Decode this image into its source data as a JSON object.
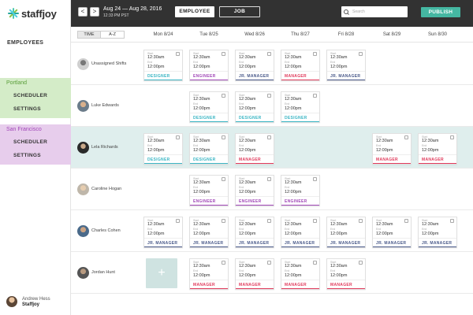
{
  "brand": {
    "name": "staffjoy"
  },
  "sidebar": {
    "employees_label": "EMPLOYEES",
    "locations": [
      {
        "name": "Portland",
        "links": [
          "SCHEDULER",
          "SETTINGS"
        ]
      },
      {
        "name": "San Francisco",
        "links": [
          "SCHEDULER",
          "SETTINGS"
        ]
      }
    ],
    "user": {
      "name": "Andrew Hess",
      "org": "Staffjoy"
    }
  },
  "topbar": {
    "prev": "<",
    "next": ">",
    "date_range": "Aug 24 — Aug 28, 2016",
    "time": "12:33 PM PST",
    "view_employee": "EMPLOYEE",
    "view_job": "JOB",
    "search_placeholder": "Search",
    "publish": "PUBLISH"
  },
  "sort": {
    "time": "TIME",
    "az": "A-Z"
  },
  "days": [
    "Mon 8/24",
    "Tue 8/25",
    "Wed 8/26",
    "Thu 8/27",
    "Fri 8/28",
    "Sat 8/29",
    "Sun 8/30"
  ],
  "shift_labels": {
    "start": "Start",
    "end": "End"
  },
  "add_symbol": "+",
  "colors": {
    "designer": "#3bb6c4",
    "engineer": "#a249b8",
    "jr_manager": "#4a5a8a",
    "manager": "#e03a5b",
    "publish": "#45b7a2",
    "topbar": "#323232"
  },
  "rows": [
    {
      "name": "Unassigned Shifts",
      "avatar": "gray",
      "highlight": false,
      "shifts": [
        {
          "day": 0,
          "start": "12:30am",
          "end": "12:00pm",
          "role": "DESIGNER"
        },
        {
          "day": 1,
          "start": "12:30am",
          "end": "12:00pm",
          "role": "ENGINEER"
        },
        {
          "day": 2,
          "start": "12:30am",
          "end": "12:00pm",
          "role": "JR. MANAGER"
        },
        {
          "day": 3,
          "start": "12:30am",
          "end": "12:00pm",
          "role": "MANAGER"
        },
        {
          "day": 4,
          "start": "12:30am",
          "end": "12:00pm",
          "role": "JR. MANAGER"
        }
      ]
    },
    {
      "name": "Luke Edwards",
      "avatar": "face",
      "highlight": false,
      "shifts": [
        {
          "day": 1,
          "start": "12:30am",
          "end": "12:00pm",
          "role": "DESIGNER"
        },
        {
          "day": 2,
          "start": "12:30am",
          "end": "12:00pm",
          "role": "DESIGNER"
        },
        {
          "day": 3,
          "start": "12:30am",
          "end": "12:00pm",
          "role": "DESIGNER"
        }
      ]
    },
    {
      "name": "Lela Richards",
      "avatar": "dark",
      "highlight": true,
      "shifts": [
        {
          "day": 0,
          "start": "12:30am",
          "end": "12:00pm",
          "role": "DESIGNER"
        },
        {
          "day": 1,
          "start": "12:30am",
          "end": "12:00pm",
          "role": "DESIGNER"
        },
        {
          "day": 2,
          "start": "12:30am",
          "end": "12:00pm",
          "role": "MANAGER"
        },
        {
          "day": 5,
          "start": "12:30am",
          "end": "12:00pm",
          "role": "MANAGER"
        },
        {
          "day": 6,
          "start": "12:30am",
          "end": "12:00pm",
          "role": "MANAGER"
        }
      ]
    },
    {
      "name": "Caroline Hogan",
      "avatar": "light",
      "highlight": false,
      "shifts": [
        {
          "day": 1,
          "start": "12:30am",
          "end": "12:00pm",
          "role": "ENGINEER"
        },
        {
          "day": 2,
          "start": "12:30am",
          "end": "12:00pm",
          "role": "ENGINEER"
        },
        {
          "day": 3,
          "start": "12:30am",
          "end": "12:00pm",
          "role": "ENGINEER"
        }
      ]
    },
    {
      "name": "Charles Cohen",
      "avatar": "blue",
      "highlight": false,
      "shifts": [
        {
          "day": 0,
          "start": "12:30am",
          "end": "12:00pm",
          "role": "JR. MANAGER"
        },
        {
          "day": 1,
          "start": "12:30am",
          "end": "12:00pm",
          "role": "JR. MANAGER"
        },
        {
          "day": 2,
          "start": "12:30am",
          "end": "12:00pm",
          "role": "JR. MANAGER"
        },
        {
          "day": 3,
          "start": "12:30am",
          "end": "12:00pm",
          "role": "JR. MANAGER"
        },
        {
          "day": 4,
          "start": "12:30am",
          "end": "12:00pm",
          "role": "JR. MANAGER"
        },
        {
          "day": 5,
          "start": "12:30am",
          "end": "12:00pm",
          "role": "JR. MANAGER"
        },
        {
          "day": 6,
          "start": "12:30am",
          "end": "12:00pm",
          "role": "JR. MANAGER"
        }
      ]
    },
    {
      "name": "Jordan Hunt",
      "avatar": "grey2",
      "highlight": false,
      "add_day": 0,
      "shifts": [
        {
          "day": 1,
          "start": "12:30am",
          "end": "12:00pm",
          "role": "MANAGER"
        },
        {
          "day": 2,
          "start": "12:30am",
          "end": "12:00pm",
          "role": "MANAGER"
        },
        {
          "day": 3,
          "start": "12:30am",
          "end": "12:00pm",
          "role": "MANAGER"
        },
        {
          "day": 4,
          "start": "12:30am",
          "end": "12:00pm",
          "role": "MANAGER"
        }
      ]
    }
  ]
}
